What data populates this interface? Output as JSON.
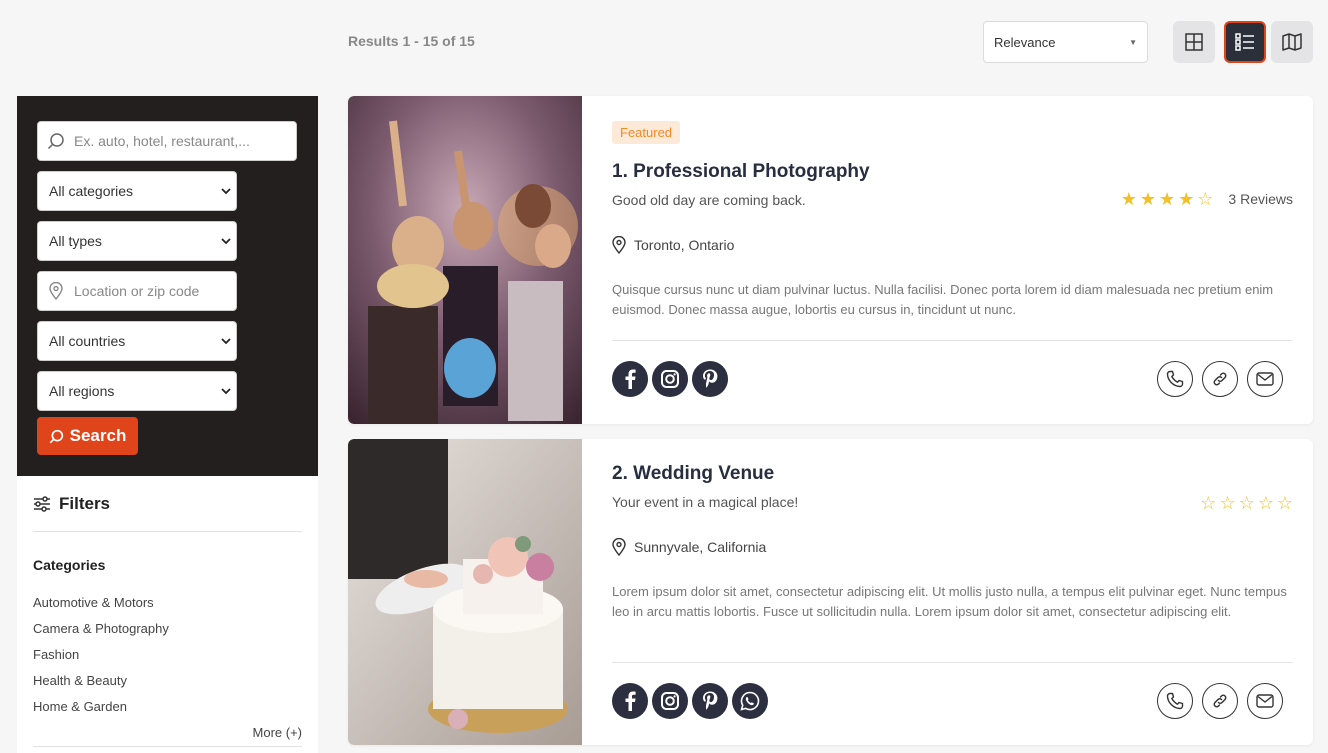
{
  "header": {
    "results_text": "Results 1 - 15 of 15",
    "sort": {
      "selected": "Relevance"
    },
    "views": [
      {
        "name": "grid-view",
        "active": false
      },
      {
        "name": "list-view",
        "active": true
      },
      {
        "name": "map-view",
        "active": false
      }
    ]
  },
  "search": {
    "keyword_placeholder": "Ex. auto, hotel, restaurant,...",
    "category": "All categories",
    "type": "All types",
    "location_placeholder": "Location or zip code",
    "country": "All countries",
    "region": "All regions",
    "button_label": "Search"
  },
  "filters": {
    "title": "Filters",
    "categories_title": "Categories",
    "categories": [
      "Automotive & Motors",
      "Camera & Photography",
      "Fashion",
      "Health & Beauty",
      "Home & Garden"
    ],
    "more_label": "More (+)"
  },
  "listings": [
    {
      "badge": "Featured",
      "title": "1. Professional Photography",
      "tagline": "Good old day are coming back.",
      "rating": 4,
      "reviews": "3 Reviews",
      "location": "Toronto, Ontario",
      "description": "Quisque cursus nunc ut diam pulvinar luctus. Nulla facilisi. Donec porta lorem id diam malesuada nec pretium enim euismod. Donec massa augue, lobortis eu cursus in, tincidunt ut nunc.",
      "socials": [
        "facebook-icon",
        "instagram-icon",
        "pinterest-icon"
      ]
    },
    {
      "title": "2. Wedding Venue",
      "tagline": "Your event in a magical place!",
      "rating": 0,
      "location": "Sunnyvale, California",
      "description": "Lorem ipsum dolor sit amet, consectetur adipiscing elit. Ut mollis justo nulla, a tempus elit pulvinar eget. Nunc tempus leo in arcu mattis lobortis. Fusce ut sollicitudin nulla. Lorem ipsum dolor sit amet, consectetur adipiscing elit.",
      "socials": [
        "facebook-icon",
        "instagram-icon",
        "pinterest-icon",
        "whatsapp-icon"
      ]
    }
  ],
  "colors": {
    "accent": "#e0441a",
    "dark_panel": "#231f1e",
    "star": "#f5c024",
    "badge_text": "#f08a24"
  }
}
